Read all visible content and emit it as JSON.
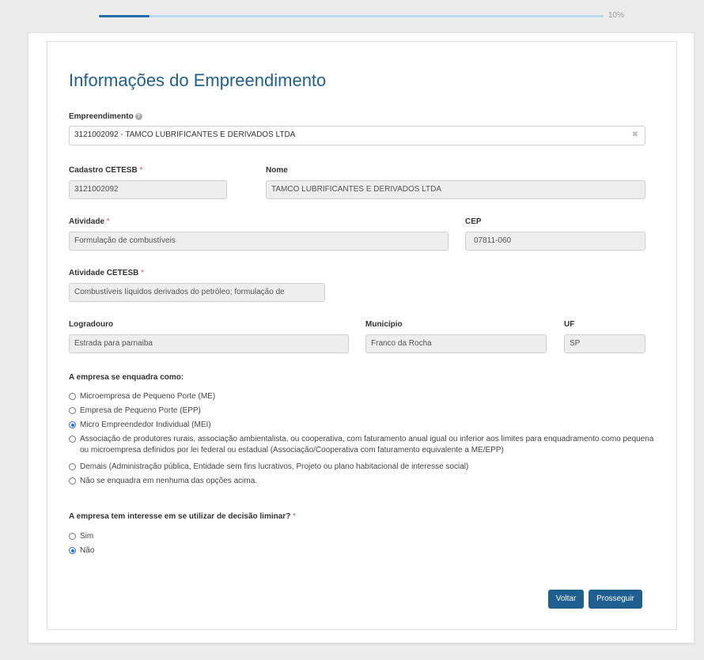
{
  "progress": {
    "percent": 10,
    "label": "10%",
    "fill_fraction": 0.1
  },
  "title": "Informações do Empreendimento",
  "empreendimento": {
    "label": "Empreendimento",
    "help_icon": "question-circle-icon",
    "value": "3121002092 - TAMCO LUBRIFICANTES E DERIVADOS LTDA",
    "clear_icon": "✖"
  },
  "fields": {
    "cadastro": {
      "label": "Cadastro CETESB",
      "required": "*",
      "value": "3121002092"
    },
    "nome": {
      "label": "Nome",
      "value": "TAMCO LUBRIFICANTES E DERIVADOS LTDA"
    },
    "atividade": {
      "label": "Atividade",
      "required": "*",
      "value": "Formulação de combustíveis"
    },
    "cep": {
      "label": "CEP",
      "value": "07811-060"
    },
    "atividade_cetesb": {
      "label": "Atividade CETESB",
      "required": "*",
      "value": "Combustíveis líquidos derivados do petróleo; formulação de"
    },
    "logradouro": {
      "label": "Logradouro",
      "value": "Estrada para parnaiba"
    },
    "municipio": {
      "label": "Município",
      "value": "Franco da Rocha"
    },
    "uf": {
      "label": "UF",
      "value": "SP"
    }
  },
  "enquadramento": {
    "title": "A empresa se enquadra como:",
    "options": [
      {
        "label": "Microempresa de Pequeno Porte (ME)",
        "checked": false
      },
      {
        "label": "Empresa de Pequeno Porte (EPP)",
        "checked": false
      },
      {
        "label": "Micro Empreendedor Individual (MEI)",
        "checked": true
      },
      {
        "label": "Associação de produtores rurais, associação ambientalista, ou cooperativa, com faturamento anual igual ou inferior aos limites para enquadramento como pequena ou microempresa definidos por lei federal ou estadual (Associação/Cooperativa com faturamento equivalente a ME/EPP)",
        "checked": false
      },
      {
        "label": "Demais (Administração pública, Entidade sem fins lucrativos, Projeto ou plano habitacional de interesse social)",
        "checked": false
      },
      {
        "label": "Não se enquadra em nenhuma das opções acima.",
        "checked": false
      }
    ]
  },
  "liminar": {
    "title": "A empresa tem interesse em se utilizar de decisão liminar?",
    "required": "*",
    "options": [
      {
        "label": "Sim",
        "checked": false
      },
      {
        "label": "Não",
        "checked": true
      }
    ]
  },
  "buttons": {
    "back": "Voltar",
    "next": "Prosseguir"
  },
  "colors": {
    "accent": "#1f5f8f",
    "progress": "#1f6fab",
    "required": "#d9534f"
  }
}
